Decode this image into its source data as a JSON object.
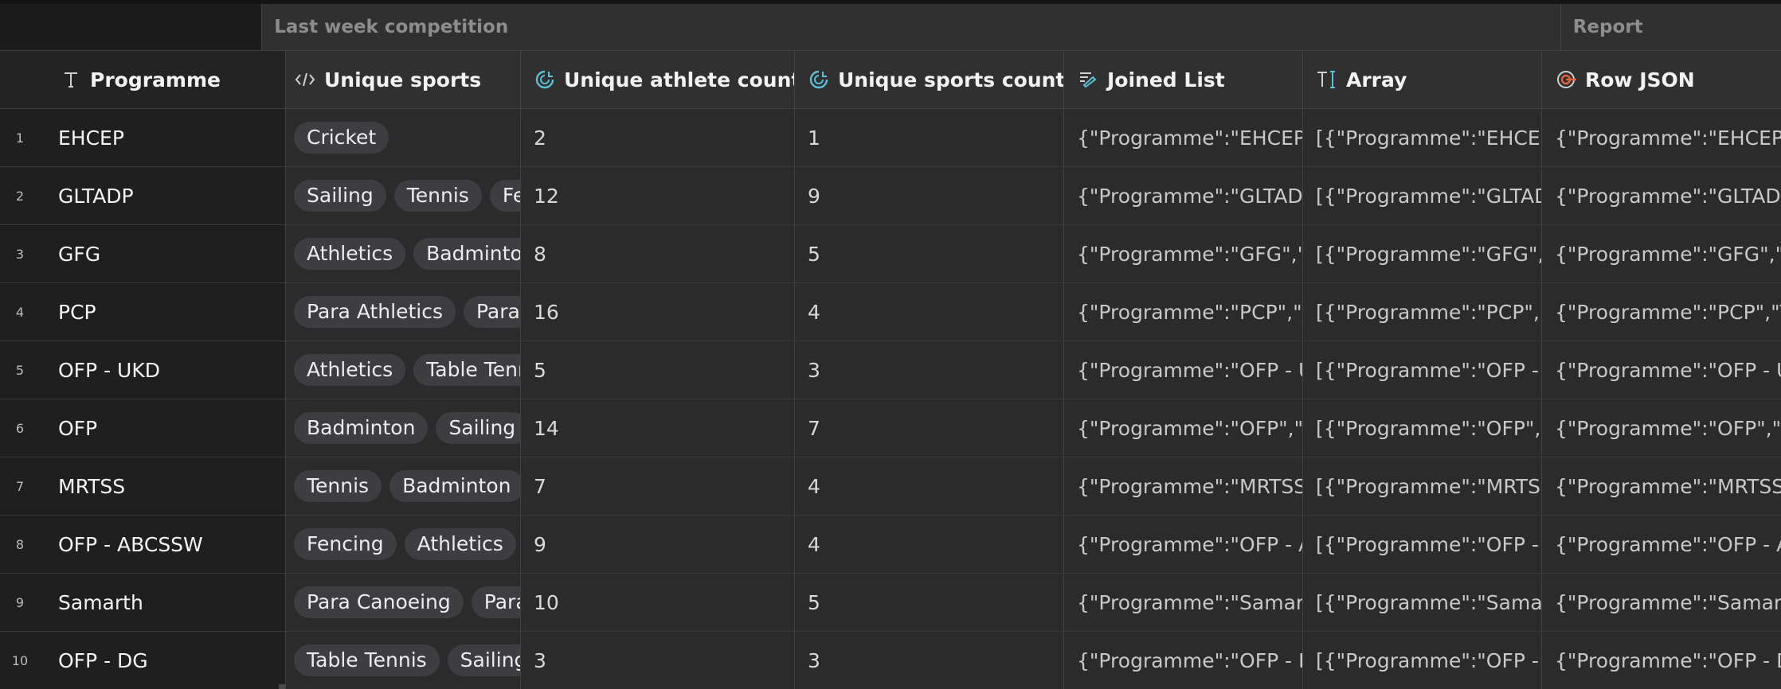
{
  "groups": [
    {
      "label": ""
    },
    {
      "label": "Last week competition"
    },
    {
      "label": "Report"
    }
  ],
  "columns": [
    {
      "label": "Programme",
      "icon": "text-type-icon"
    },
    {
      "label": "Unique sports",
      "icon": "code-icon"
    },
    {
      "label": "Unique athlete count",
      "icon": "rollup-icon"
    },
    {
      "label": "Unique sports count",
      "icon": "rollup-icon"
    },
    {
      "label": "Joined List",
      "icon": "formula-list-icon"
    },
    {
      "label": "Array",
      "icon": "text-cursor-icon"
    },
    {
      "label": "Row JSON",
      "icon": "target-icon"
    }
  ],
  "rows": [
    {
      "num": "1",
      "programme": "EHCEP",
      "sports": [
        "Cricket"
      ],
      "athletes": "2",
      "sports_count": "1",
      "joined": "{\"Programme\":\"EHCEP",
      "array": "[{\"Programme\":\"EHCEP",
      "json": "{\"Programme\":\"EHCEP"
    },
    {
      "num": "2",
      "programme": "GLTADP",
      "sports": [
        "Sailing",
        "Tennis",
        "Fe"
      ],
      "athletes": "12",
      "sports_count": "9",
      "joined": "{\"Programme\":\"GLTADI",
      "array": "[{\"Programme\":\"GLTAD",
      "json": "{\"Programme\":\"GLTADI"
    },
    {
      "num": "3",
      "programme": "GFG",
      "sports": [
        "Athletics",
        "Badminton"
      ],
      "athletes": "8",
      "sports_count": "5",
      "joined": "{\"Programme\":\"GFG\",\"A",
      "array": "[{\"Programme\":\"GFG\",\"",
      "json": "{\"Programme\":\"GFG\",\"T"
    },
    {
      "num": "4",
      "programme": "PCP",
      "sports": [
        "Para Athletics",
        "Para"
      ],
      "athletes": "16",
      "sports_count": "4",
      "joined": "{\"Programme\":\"PCP\",\"A",
      "array": "[{\"Programme\":\"PCP\",\"",
      "json": "{\"Programme\":\"PCP\",\"T"
    },
    {
      "num": "5",
      "programme": "OFP - UKD",
      "sports": [
        "Athletics",
        "Table Tenn"
      ],
      "athletes": "5",
      "sports_count": "3",
      "joined": "{\"Programme\":\"OFP - U",
      "array": "[{\"Programme\":\"OFP -",
      "json": "{\"Programme\":\"OFP - U"
    },
    {
      "num": "6",
      "programme": "OFP",
      "sports": [
        "Badminton",
        "Sailing"
      ],
      "athletes": "14",
      "sports_count": "7",
      "joined": "{\"Programme\":\"OFP\",\"A",
      "array": "[{\"Programme\":\"OFP\",\"",
      "json": "{\"Programme\":\"OFP\",\"T"
    },
    {
      "num": "7",
      "programme": "MRTSS",
      "sports": [
        "Tennis",
        "Badminton"
      ],
      "athletes": "7",
      "sports_count": "4",
      "joined": "{\"Programme\":\"MRTSS",
      "array": "[{\"Programme\":\"MRTS",
      "json": "{\"Programme\":\"MRTSS"
    },
    {
      "num": "8",
      "programme": "OFP - ABCSSW",
      "sports": [
        "Fencing",
        "Athletics"
      ],
      "athletes": "9",
      "sports_count": "4",
      "joined": "{\"Programme\":\"OFP - A",
      "array": "[{\"Programme\":\"OFP -",
      "json": "{\"Programme\":\"OFP - A"
    },
    {
      "num": "9",
      "programme": "Samarth",
      "sports": [
        "Para Canoeing",
        "Para"
      ],
      "athletes": "10",
      "sports_count": "5",
      "joined": "{\"Programme\":\"Samart",
      "array": "[{\"Programme\":\"Samar",
      "json": "{\"Programme\":\"Samart"
    },
    {
      "num": "10",
      "programme": "OFP - DG",
      "sports": [
        "Table Tennis",
        "Sailing"
      ],
      "athletes": "3",
      "sports_count": "3",
      "joined": "{\"Programme\":\"OFP - D",
      "array": "[{\"Programme\":\"OFP -",
      "json": "{\"Programme\":\"OFP - D"
    }
  ],
  "colors": {
    "background": "#2c2c2c",
    "frozen_column": "#1f1f1f",
    "tag_background": "#3e3e42",
    "icon_accent": "#5bc0d8",
    "icon_orange": "#e0623a"
  }
}
